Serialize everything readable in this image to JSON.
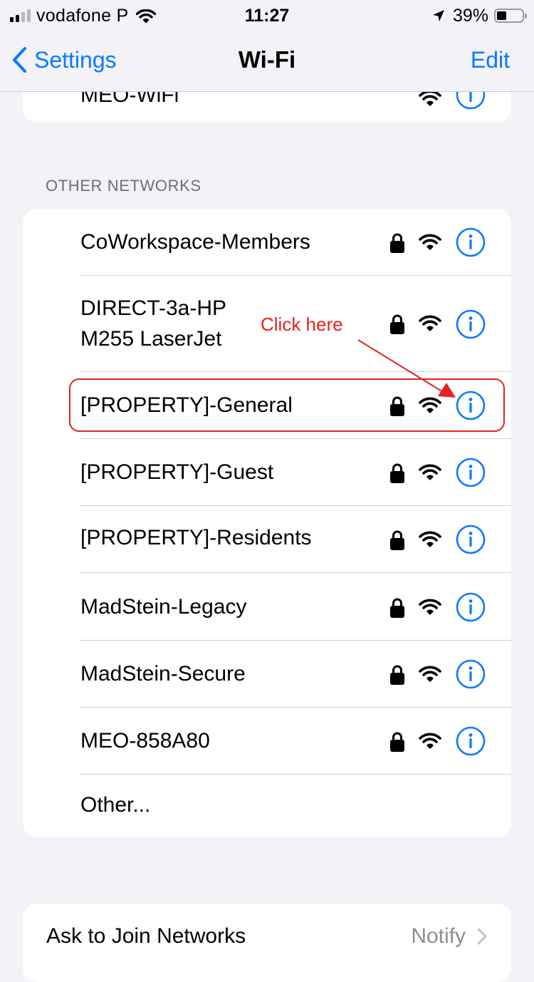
{
  "status_bar": {
    "carrier": "vodafone P",
    "time": "11:27",
    "battery": "39%",
    "battery_level": 0.39,
    "signal_bars": 2
  },
  "nav": {
    "back_label": "Settings",
    "title": "Wi-Fi",
    "edit_label": "Edit"
  },
  "current_network": {
    "name": "MEO-WiFi"
  },
  "other_networks": {
    "header": "OTHER NETWORKS",
    "items": [
      {
        "name": "CoWorkspace-Members"
      },
      {
        "name_line1": "DIRECT-3a-HP",
        "name_line2": "M255 LaserJet"
      },
      {
        "name": "[PROPERTY]-General"
      },
      {
        "name": "[PROPERTY]-Guest"
      },
      {
        "name": "[PROPERTY]-Residents"
      },
      {
        "name": "MadStein-Legacy"
      },
      {
        "name": "MadStein-Secure"
      },
      {
        "name": "MEO-858A80"
      }
    ],
    "other_label": "Other..."
  },
  "ask_to_join": {
    "label": "Ask to Join Networks",
    "value": "Notify"
  },
  "annotation": {
    "text": "Click here"
  },
  "colors": {
    "accent": "#0a7aff",
    "annotation": "#e32222",
    "background": "#f2f2f7"
  },
  "icons": [
    "signal-icon",
    "wifi-icon",
    "location-arrow-icon",
    "battery-icon",
    "chevron-left-icon",
    "lock-icon",
    "info-icon",
    "chevron-right-icon"
  ]
}
